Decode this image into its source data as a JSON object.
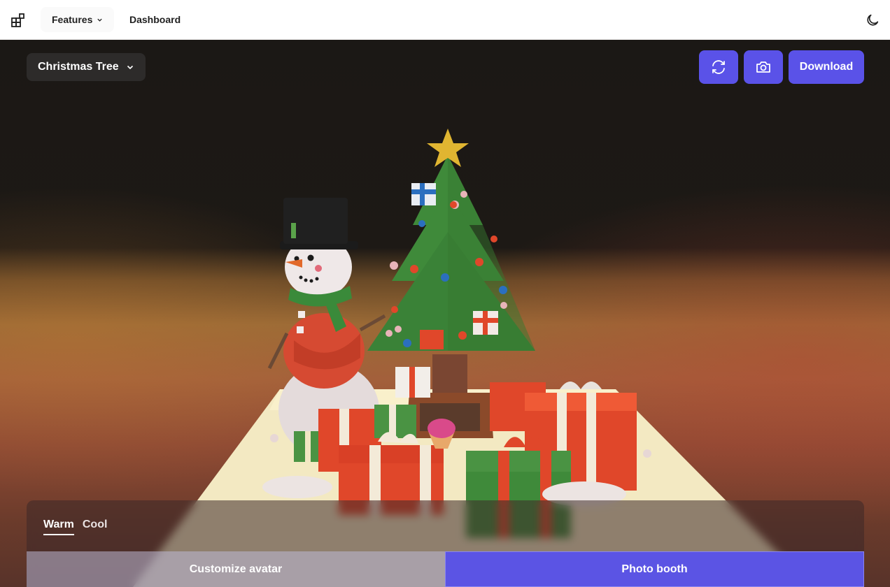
{
  "nav": {
    "logo_icon": "grid-blocks-icon",
    "features_label": "Features",
    "dashboard_label": "Dashboard",
    "theme_icon": "moon-icon"
  },
  "scene_selector": {
    "label": "Christmas Tree"
  },
  "actions": {
    "refresh_icon": "refresh-icon",
    "camera_icon": "camera-icon",
    "download_label": "Download"
  },
  "tone_tabs": [
    {
      "label": "Warm",
      "active": true
    },
    {
      "label": "Cool",
      "active": false
    }
  ],
  "modes": {
    "customize_label": "Customize avatar",
    "photo_booth_label": "Photo booth"
  },
  "colors": {
    "accent": "#5a52e8",
    "nav_bg": "#ffffff",
    "stage_dark": "#1b1816",
    "tree_green": "#3f8a3a",
    "gift_red": "#e0472a",
    "star_gold": "#e0b531"
  }
}
